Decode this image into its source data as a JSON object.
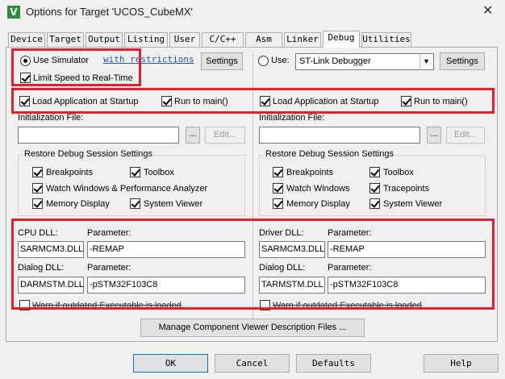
{
  "window": {
    "title": "Options for Target 'UCOS_CubeMX'",
    "icon": "keil-uvision-icon",
    "close_glyph": "✕"
  },
  "tabs": [
    {
      "label": "Device"
    },
    {
      "label": "Target"
    },
    {
      "label": "Output"
    },
    {
      "label": "Listing"
    },
    {
      "label": "User"
    },
    {
      "label": "C/C++"
    },
    {
      "label": "Asm"
    },
    {
      "label": "Linker"
    },
    {
      "label": "Debug",
      "active": true
    },
    {
      "label": "Utilities"
    }
  ],
  "left": {
    "use_simulator": "Use Simulator",
    "with_restrictions": "with restrictions",
    "settings": "Settings",
    "limit_speed": "Limit Speed to Real-Time",
    "load_app": "Load Application at Startup",
    "run_to_main": "Run to main()",
    "init_file_label": "Initialization File:",
    "init_file_value": "",
    "browse": "...",
    "edit": "Edit...",
    "restore_title": "Restore Debug Session Settings",
    "breakpoints": "Breakpoints",
    "toolbox": "Toolbox",
    "watch_windows": "Watch Windows & Performance Analyzer",
    "memory_display": "Memory Display",
    "system_viewer": "System Viewer",
    "cpu_dll_label": "CPU DLL:",
    "cpu_param_label": "Parameter:",
    "cpu_dll": "SARMCM3.DLL",
    "cpu_param": "-REMAP",
    "dialog_dll_label": "Dialog DLL:",
    "dialog_param_label": "Parameter:",
    "dialog_dll": "DARMSTM.DLL",
    "dialog_param": "-pSTM32F103C8",
    "warn_outdated": "Warn if outdated Executable is loaded"
  },
  "right": {
    "use": "Use:",
    "debugger": "ST-Link Debugger",
    "settings": "Settings",
    "load_app": "Load Application at Startup",
    "run_to_main": "Run to main()",
    "init_file_label": "Initialization File:",
    "init_file_value": "",
    "browse": "...",
    "edit": "Edit...",
    "restore_title": "Restore Debug Session Settings",
    "breakpoints": "Breakpoints",
    "toolbox": "Toolbox",
    "watch_windows": "Watch Windows",
    "tracepoints": "Tracepoints",
    "memory_display": "Memory Display",
    "system_viewer": "System Viewer",
    "driver_dll_label": "Driver DLL:",
    "driver_param_label": "Parameter:",
    "driver_dll": "SARMCM3.DLL",
    "driver_param": "-REMAP",
    "dialog_dll_label": "Dialog DLL:",
    "dialog_param_label": "Parameter:",
    "dialog_dll": "TARMSTM.DLL",
    "dialog_param": "-pSTM32F103C8",
    "warn_outdated": "Warn if outdated Executable is loaded"
  },
  "manage_button": "Manage Component Viewer Description Files ...",
  "footer": {
    "ok": "OK",
    "cancel": "Cancel",
    "defaults": "Defaults",
    "help": "Help"
  },
  "annotation_color": "#e5202e"
}
